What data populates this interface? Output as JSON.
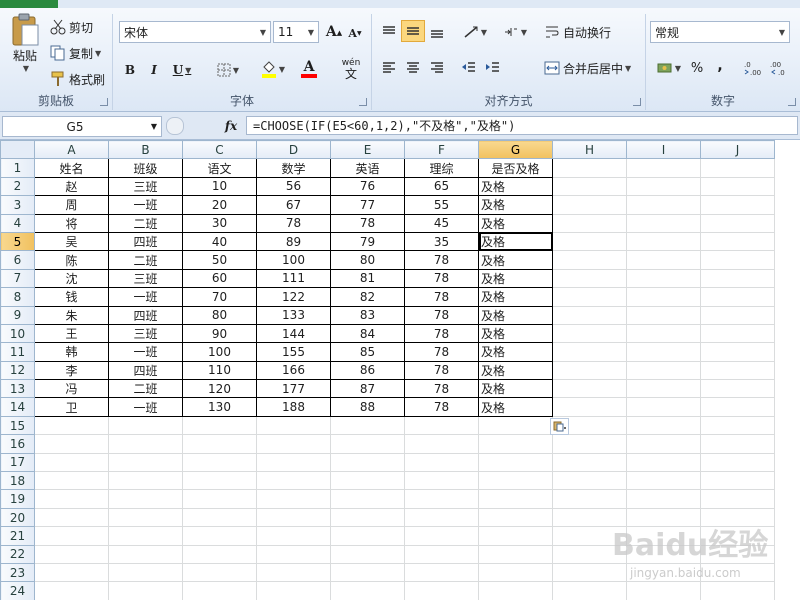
{
  "ribbon": {
    "clipboard": {
      "label": "剪贴板",
      "paste": "粘贴",
      "cut": "剪切",
      "copy": "复制",
      "format_painter": "格式刷"
    },
    "font": {
      "label": "字体",
      "font_name": "宋体",
      "font_size": "11",
      "bold": "B",
      "italic": "I",
      "underline": "U",
      "grow": "A",
      "shrink": "A",
      "font_color": "A",
      "wen": "wén",
      "wen_char": "文"
    },
    "alignment": {
      "label": "对齐方式",
      "wrap_text": "自动换行",
      "merge_center": "合并后居中"
    },
    "number": {
      "label": "数字",
      "format": "常规",
      "percent": "%",
      "comma": ","
    }
  },
  "formula_bar": {
    "name_box": "G5",
    "fx": "fx",
    "formula": "=CHOOSE(IF(E5<60,1,2),\"不及格\",\"及格\")"
  },
  "sheet": {
    "columns": [
      "A",
      "B",
      "C",
      "D",
      "E",
      "F",
      "G",
      "H",
      "I",
      "J"
    ],
    "selected_column": "G",
    "selected_row": 5,
    "row_count": 24,
    "rows": [
      [
        "姓名",
        "班级",
        "语文",
        "数学",
        "英语",
        "理综",
        "是否及格"
      ],
      [
        "赵",
        "三班",
        "10",
        "56",
        "76",
        "65",
        "及格"
      ],
      [
        "周",
        "一班",
        "20",
        "67",
        "77",
        "55",
        "及格"
      ],
      [
        "将",
        "二班",
        "30",
        "78",
        "78",
        "45",
        "及格"
      ],
      [
        "吴",
        "四班",
        "40",
        "89",
        "79",
        "35",
        "及格"
      ],
      [
        "陈",
        "二班",
        "50",
        "100",
        "80",
        "78",
        "及格"
      ],
      [
        "沈",
        "三班",
        "60",
        "111",
        "81",
        "78",
        "及格"
      ],
      [
        "钱",
        "一班",
        "70",
        "122",
        "82",
        "78",
        "及格"
      ],
      [
        "朱",
        "四班",
        "80",
        "133",
        "83",
        "78",
        "及格"
      ],
      [
        "王",
        "三班",
        "90",
        "144",
        "84",
        "78",
        "及格"
      ],
      [
        "韩",
        "一班",
        "100",
        "155",
        "85",
        "78",
        "及格"
      ],
      [
        "李",
        "四班",
        "110",
        "166",
        "86",
        "78",
        "及格"
      ],
      [
        "冯",
        "二班",
        "120",
        "177",
        "87",
        "78",
        "及格"
      ],
      [
        "卫",
        "一班",
        "130",
        "188",
        "88",
        "78",
        "及格"
      ]
    ]
  },
  "watermark": {
    "brand": "Baidu经验",
    "url": "jingyan.baidu.com"
  },
  "colors": {
    "selection_header": "#f1c15f",
    "header_bg": "#e4ecf7",
    "gridline": "#dadcdd",
    "file_tab": "#2a8a3e"
  }
}
